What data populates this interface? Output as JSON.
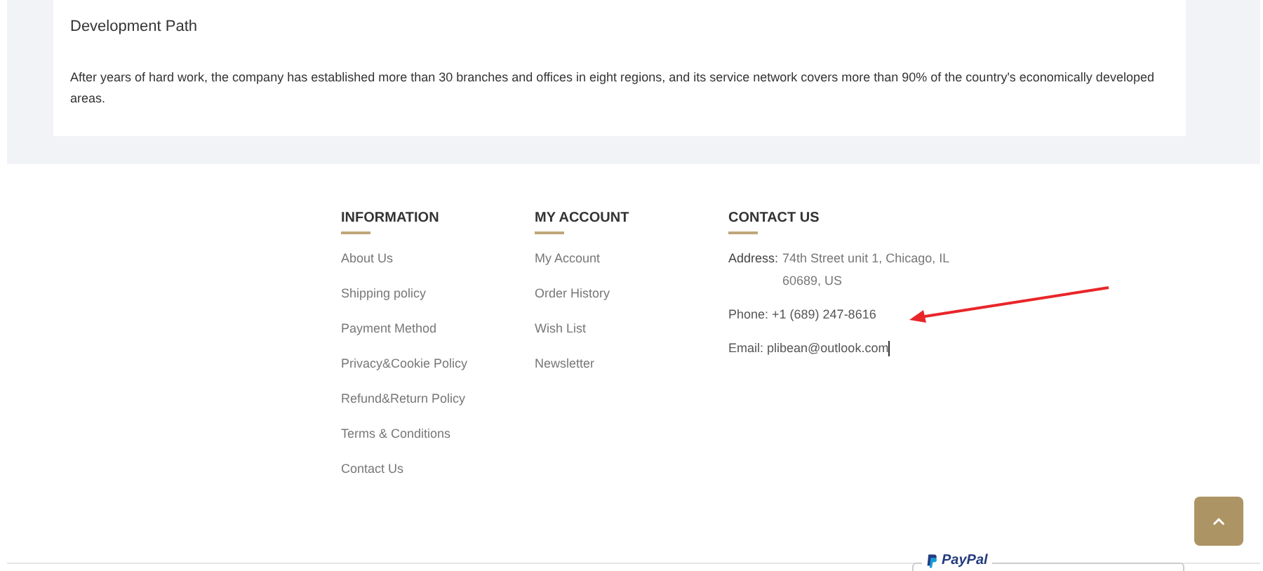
{
  "article": {
    "heading": "Development Path",
    "body": "After years of hard work, the company has established more than 30 branches and offices in eight regions, and its service network covers more than 90% of the country's economically developed areas."
  },
  "footer": {
    "columns": [
      {
        "title": "INFORMATION",
        "links": [
          "About Us",
          "Shipping policy",
          "Payment Method",
          "Privacy&Cookie Policy",
          "Refund&Return Policy",
          "Terms & Conditions",
          "Contact Us"
        ]
      },
      {
        "title": "MY ACCOUNT",
        "links": [
          "My Account",
          "Order History",
          "Wish List",
          "Newsletter"
        ]
      }
    ],
    "contact": {
      "title": "CONTACT US",
      "address_label": "Address:",
      "address_line_1": "74th Street unit 1,  Chicago, IL",
      "address_line_2": "60689, US",
      "phone": "Phone: +1 (689) 247-8616",
      "email": "Email: plibean@outlook.com"
    }
  },
  "payment": {
    "logo": "PayPal"
  }
}
